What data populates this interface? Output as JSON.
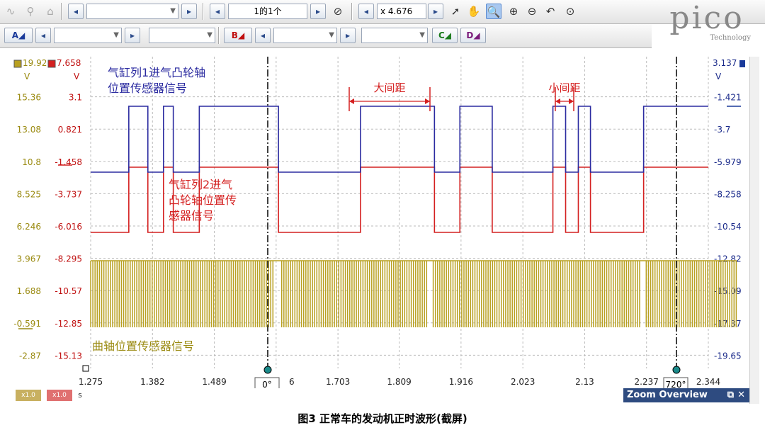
{
  "toolbar1": {
    "page_label": "1的1个",
    "zoom_value": "x 4.676"
  },
  "logo": {
    "name": "pico",
    "sub": "Technology"
  },
  "toolbar2": {
    "chan_a": "A",
    "chan_b": "B",
    "chan_c": "C",
    "chan_d": "D"
  },
  "colors": {
    "blue": "#2b2ba0",
    "red": "#d42020",
    "gold": "#b8a020"
  },
  "chart_data": {
    "type": "line",
    "xlim": [
      1.275,
      2.344
    ],
    "x_ticks": [
      "1.275",
      "1.382",
      "1.489",
      "1.596",
      "1.703",
      "1.809",
      "1.916",
      "2.023",
      "2.13",
      "2.237",
      "2.344"
    ],
    "x_unit": "s",
    "left_axis_A": {
      "top": "19.92",
      "unit": "V",
      "ticks": [
        "15.36",
        "13.08",
        "10.8",
        "8.525",
        "6.246",
        "3.967",
        "1.688",
        "-0.591",
        "-2.87"
      ]
    },
    "left_axis_B": {
      "top": "7.658",
      "unit": "V",
      "ticks": [
        "3.1",
        "0.821",
        "-1.458",
        "-3.737",
        "-6.016",
        "-8.295",
        "-10.57",
        "-12.85",
        "-15.13"
      ]
    },
    "right_axis": {
      "top": "3.137",
      "unit": "V",
      "ticks": [
        "-1.421",
        "-3.7",
        "-5.979",
        "-8.258",
        "-10.54",
        "-12.82",
        "-15.09",
        "-17.37",
        "-19.65"
      ]
    },
    "series": [
      {
        "name": "气缸列1进气凸轮轴位置传感器信号",
        "color": "#2b2ba0",
        "low": 0,
        "high": 1,
        "edges": [
          1.275,
          1.341,
          1.374,
          1.401,
          1.418,
          1.463,
          1.6,
          1.742,
          1.87,
          1.914,
          1.97,
          2.075,
          2.097,
          2.119,
          2.14,
          2.232
        ]
      },
      {
        "name": "气缸列2进气凸轮轴位置传感器信号",
        "color": "#d42020",
        "low": 0,
        "high": 1,
        "edges": [
          1.275,
          1.341,
          1.374,
          1.401,
          1.418,
          1.463,
          1.6,
          1.742,
          1.87,
          1.914,
          1.97,
          2.075,
          2.097,
          2.119,
          2.14,
          2.232
        ]
      },
      {
        "name": "曲轴位置传感器信号",
        "color": "#b8a020"
      }
    ],
    "annotations": {
      "big_gap": "大间距",
      "small_gap": "小间距"
    },
    "markers": {
      "left": "0°",
      "right": "720°"
    }
  },
  "footer": {
    "a_scale": "x1.0",
    "b_scale": "x1.0",
    "unit": "s"
  },
  "zoom_overview": "Zoom Overview",
  "caption": "图3   正常车的发动机正时波形(截屏)"
}
